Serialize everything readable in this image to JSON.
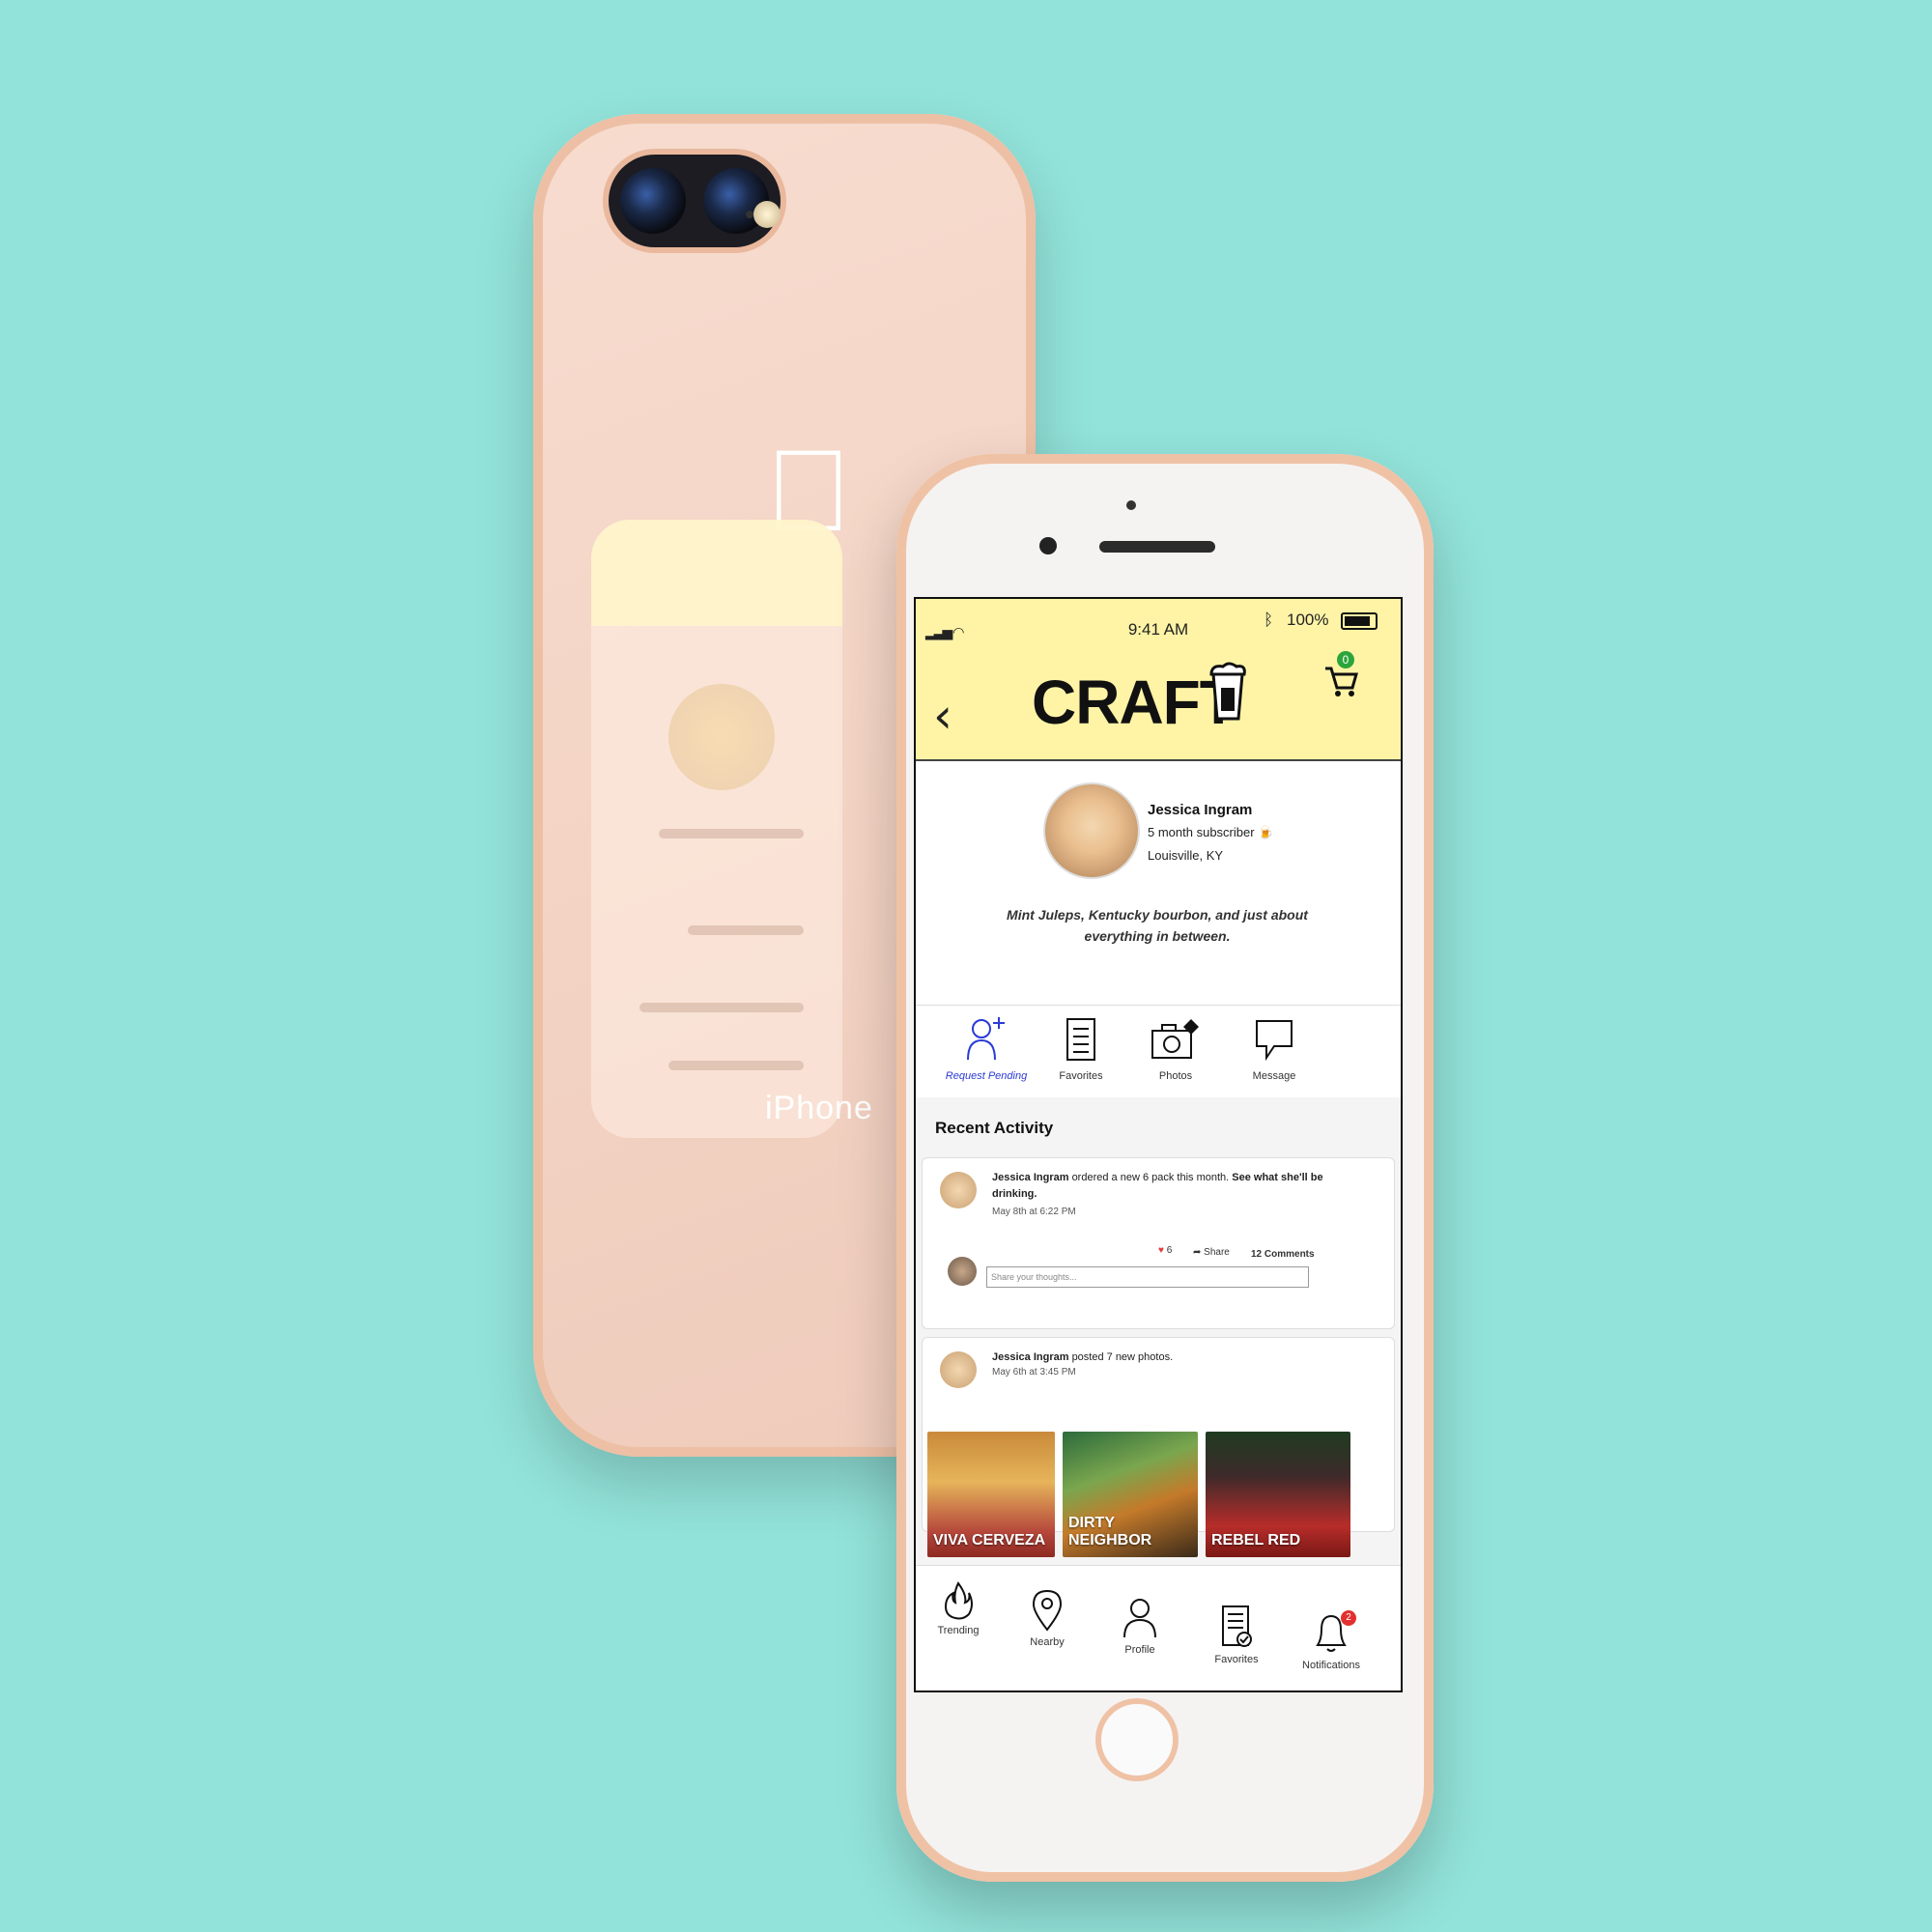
{
  "colors": {
    "background": "#92e3da",
    "header": "#fff4a6",
    "accent_blue": "#2a3ad6",
    "cart_badge": "#2ca53b",
    "notification_badge": "#e23030",
    "heart": "#e23b3b"
  },
  "back_phone": {
    "brand_text": "iPhone"
  },
  "status_bar": {
    "time": "9:41 AM",
    "battery": "100%"
  },
  "header": {
    "title": "CRAFT",
    "cart_count": "0"
  },
  "profile": {
    "name": "Jessica Ingram",
    "subscription": "5 month subscriber",
    "location": "Louisville, KY",
    "bio": "Mint Juleps, Kentucky bourbon, and just about everything in between."
  },
  "actions": [
    {
      "label": "Request Pending",
      "icon": "add-user-icon"
    },
    {
      "label": "Favorites",
      "icon": "list-icon"
    },
    {
      "label": "Photos",
      "icon": "camera-icon"
    },
    {
      "label": "Message",
      "icon": "message-icon"
    }
  ],
  "recent_activity": {
    "title": "Recent Activity",
    "items": [
      {
        "user": "Jessica Ingram",
        "text": "ordered a new 6 pack this month.",
        "link": "See what she'll be drinking.",
        "date": "May 8th at 6:22 PM",
        "likes": "6",
        "share": "Share",
        "comments": "12 Comments",
        "comment_placeholder": "Share your thoughts..."
      },
      {
        "user": "Jessica Ingram",
        "text": "posted 7 new photos.",
        "date": "May 6th at 3:45 PM"
      }
    ],
    "photo_captions": [
      "VIVA CERVEZA",
      "DIRTY NEIGHBOR",
      "REBEL RED"
    ]
  },
  "tabbar": {
    "items": [
      {
        "label": "Trending",
        "icon": "flame-icon"
      },
      {
        "label": "Nearby",
        "icon": "map-pin-icon"
      },
      {
        "label": "Profile",
        "icon": "person-icon"
      },
      {
        "label": "Favorites",
        "icon": "checklist-icon"
      },
      {
        "label": "Notifications",
        "icon": "bell-icon"
      }
    ],
    "notification_count": "2"
  }
}
